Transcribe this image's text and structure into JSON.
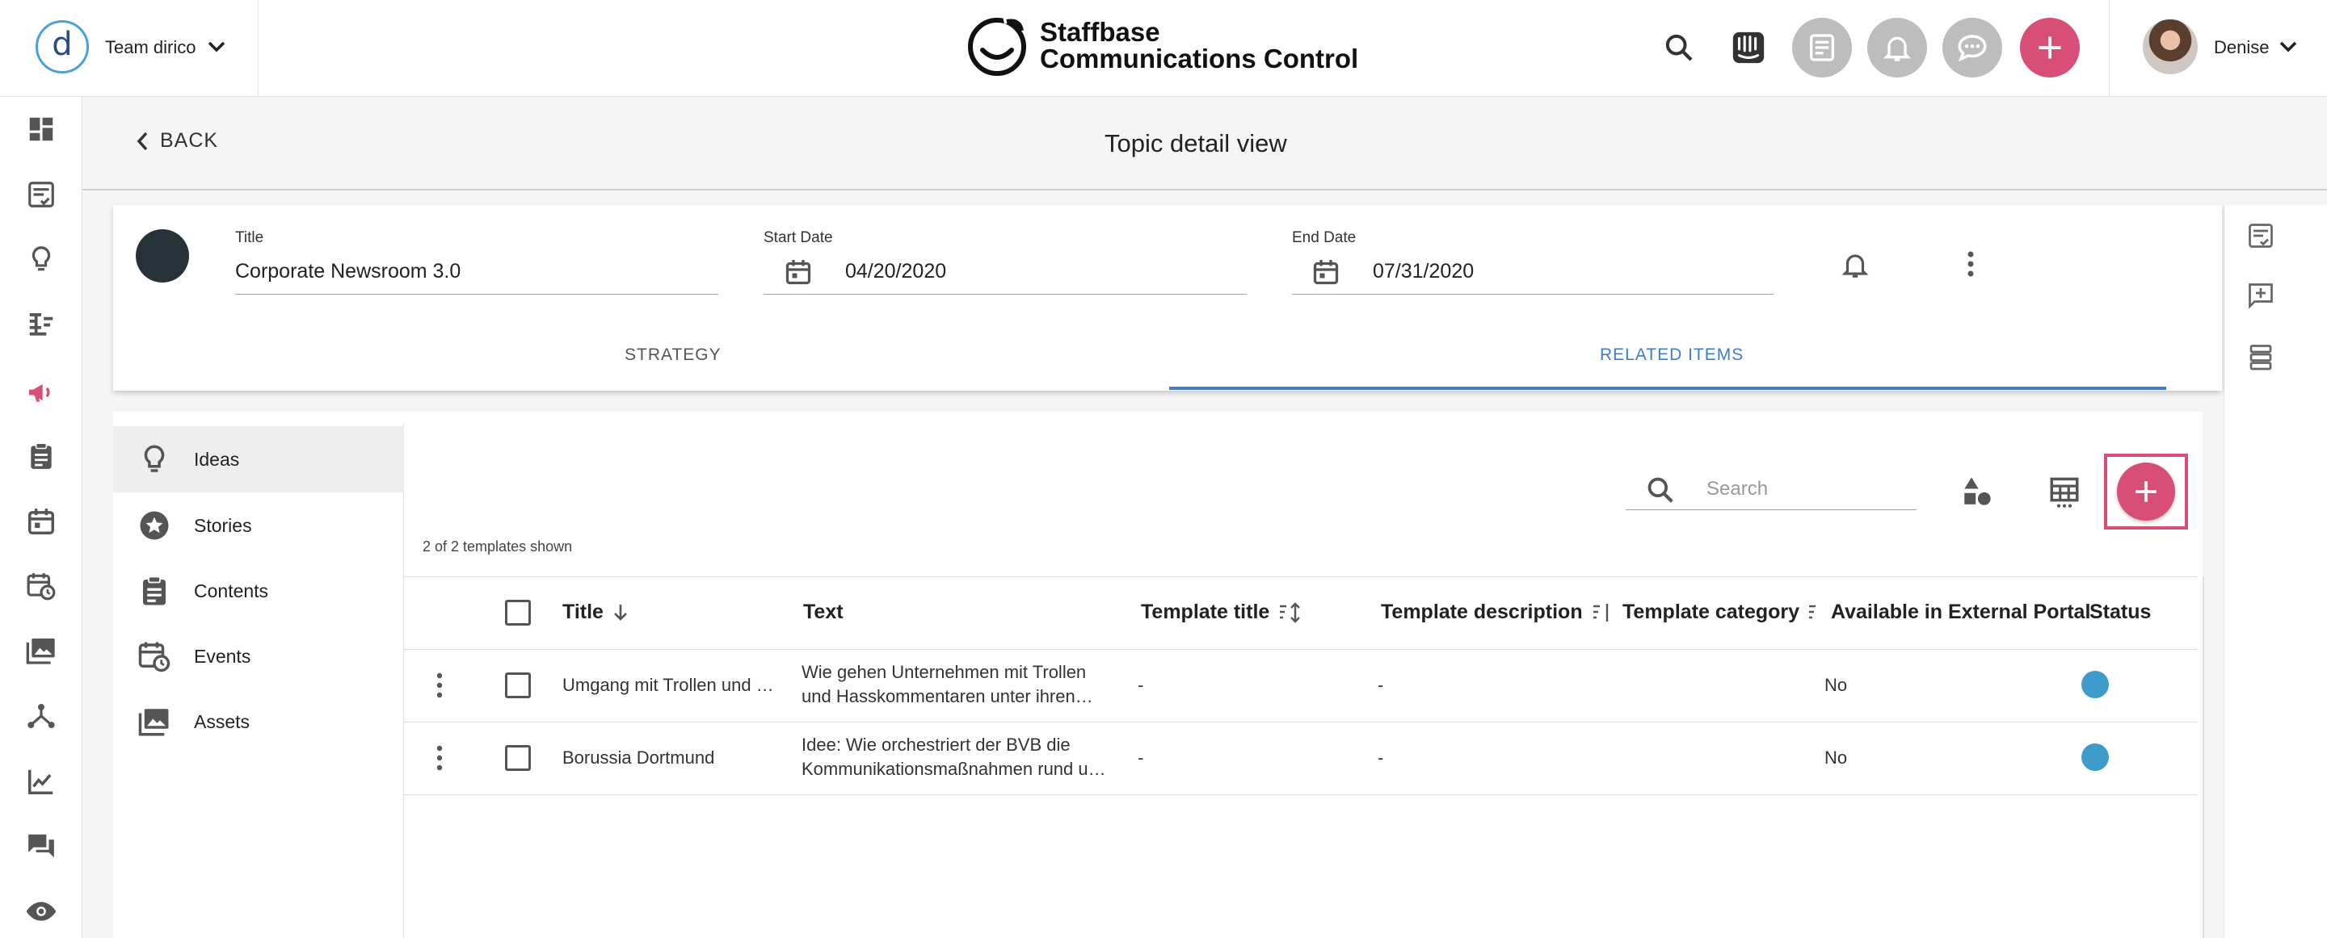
{
  "team": {
    "name": "Team dirico",
    "logo_letter": "d"
  },
  "brand": {
    "line1": "Staffbase",
    "line2": "Communications Control"
  },
  "user": {
    "name": "Denise"
  },
  "colors": {
    "accent": "#d74f76",
    "tab_active": "#3f7ec4",
    "status": "#3d9cc9",
    "grey_button": "#bdbdbd"
  },
  "subheader": {
    "back_label": "BACK",
    "title": "Topic detail view"
  },
  "topic": {
    "title_label": "Title",
    "title_value": "Corporate Newsroom 3.0",
    "start_label": "Start Date",
    "start_value": "04/20/2020",
    "end_label": "End Date",
    "end_value": "07/31/2020"
  },
  "tabs": [
    {
      "label": "STRATEGY",
      "active": false
    },
    {
      "label": "RELATED ITEMS",
      "active": true
    }
  ],
  "sidebar": {
    "items": [
      {
        "label": "Ideas",
        "icon": "lightbulb-icon",
        "active": true
      },
      {
        "label": "Stories",
        "icon": "star-badge-icon",
        "active": false
      },
      {
        "label": "Contents",
        "icon": "clipboard-icon",
        "active": false
      },
      {
        "label": "Events",
        "icon": "calendar-clock-icon",
        "active": false
      },
      {
        "label": "Assets",
        "icon": "images-icon",
        "active": false
      }
    ]
  },
  "toolbar": {
    "search_placeholder": "Search",
    "count_text": "2 of 2 templates shown"
  },
  "table": {
    "columns": [
      "Title",
      "Text",
      "Template title",
      "Template description",
      "Template category",
      "Available in External Portal",
      "Status"
    ],
    "rows": [
      {
        "title": "Umgang mit Trollen und …",
        "text_line1": "Wie gehen Unternehmen mit Trollen",
        "text_line2": "und Hasskommentaren unter ihren…",
        "template_title": "-",
        "template_description": "-",
        "external_portal": "No"
      },
      {
        "title": "Borussia Dortmund",
        "text_line1": "Idee:  Wie orchestriert der BVB die",
        "text_line2": "Kommunikationsmaßnahmen rund u…",
        "template_title": "-",
        "template_description": "-",
        "external_portal": "No"
      }
    ]
  }
}
